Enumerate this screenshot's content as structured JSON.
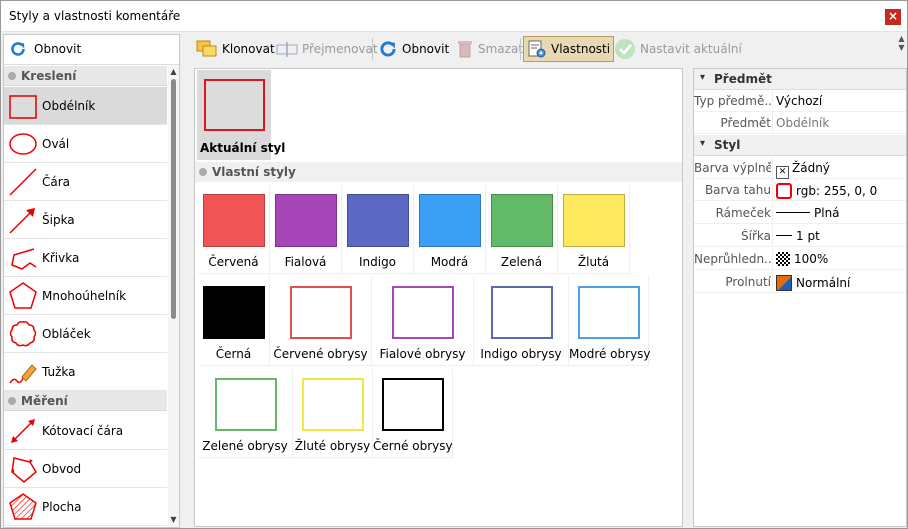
{
  "window": {
    "title": "Styly a vlastnosti komentáře"
  },
  "left": {
    "refresh_label": "Obnovit",
    "sections": [
      {
        "label": "Kreslení",
        "tools": [
          "Obdélník",
          "Ovál",
          "Čára",
          "Šipka",
          "Křivka",
          "Mnohoúhelník",
          "Obláček",
          "Tužka"
        ]
      },
      {
        "label": "Měření",
        "tools": [
          "Kótovací čára",
          "Obvod",
          "Plocha"
        ]
      }
    ],
    "selected_tool": "Obdélník"
  },
  "toolbar": {
    "clone": "Klonovat",
    "rename": "Přejmenovat",
    "refresh": "Obnovit",
    "delete": "Smazat",
    "properties": "Vlastnosti",
    "set_current": "Nastavit aktuální"
  },
  "center": {
    "current_label": "Aktuální styl",
    "custom_section": "Vlastní styly",
    "filled": [
      {
        "label": "Červená",
        "color": "#f05454"
      },
      {
        "label": "Fialová",
        "color": "#a646b9"
      },
      {
        "label": "Indigo",
        "color": "#5c69c2"
      },
      {
        "label": "Modrá",
        "color": "#3b9ff5"
      },
      {
        "label": "Zelená",
        "color": "#62ba68"
      },
      {
        "label": "Žlutá",
        "color": "#fde95b"
      },
      {
        "label": "Černá",
        "color": "#000000"
      }
    ],
    "outlines": [
      {
        "label": "Červené obrysy",
        "color": "#e0504e"
      },
      {
        "label": "Fialové obrysy",
        "color": "#a646b9"
      },
      {
        "label": "Indigo obrysy",
        "color": "#5c69b2"
      },
      {
        "label": "Modré obrysy",
        "color": "#4c9fe8"
      },
      {
        "label": "Zelené obrysy",
        "color": "#66b56a"
      },
      {
        "label": "Žluté obrysy",
        "color": "#f2e64a"
      },
      {
        "label": "Černé obrysy",
        "color": "#000000"
      }
    ]
  },
  "properties": {
    "subject_section": "Předmět",
    "type_key": "Typ předmě..",
    "type_val": "Výchozí",
    "subject_key": "Předmět",
    "subject_val": "Obdélník",
    "style_section": "Styl",
    "fill_key": "Barva výplně",
    "fill_val": "Žádný",
    "stroke_key": "Barva tahu",
    "stroke_val": "rgb: 255, 0, 0",
    "stroke_color": "#ff0000",
    "border_key": "Rámeček",
    "border_val": "Plná",
    "width_key": "Šířka",
    "width_val": "1 pt",
    "opacity_key": "Neprůhledn..",
    "opacity_val": "100%",
    "blend_key": "Prolnutí",
    "blend_val": "Normální"
  }
}
